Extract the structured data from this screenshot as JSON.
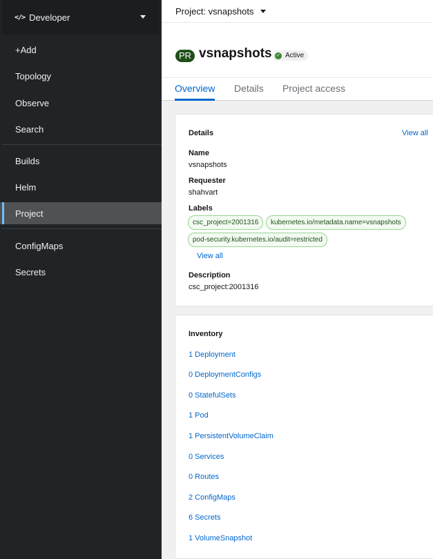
{
  "sidebar": {
    "perspective": "Developer",
    "items": [
      {
        "label": "+Add"
      },
      {
        "label": "Topology"
      },
      {
        "label": "Observe"
      },
      {
        "label": "Search"
      },
      {
        "label": "Builds"
      },
      {
        "label": "Helm"
      },
      {
        "label": "Project"
      },
      {
        "label": "ConfigMaps"
      },
      {
        "label": "Secrets"
      }
    ]
  },
  "topbar": {
    "project_selector": "Project: vsnapshots"
  },
  "header": {
    "badge": "PR",
    "title": "vsnapshots",
    "status": "Active"
  },
  "tabs": [
    "Overview",
    "Details",
    "Project access"
  ],
  "details": {
    "title": "Details",
    "view_all": "View all",
    "name_label": "Name",
    "name_value": "vsnapshots",
    "requester_label": "Requester",
    "requester_value": "shahvart",
    "labels_label": "Labels",
    "labels": [
      "csc_project=2001316",
      "kubernetes.io/metadata.name=vsnapshots",
      "pod-security.kubernetes.io/audit=restricted"
    ],
    "labels_view_all": "View all",
    "description_label": "Description",
    "description_value": "csc_project:2001316"
  },
  "inventory": {
    "title": "Inventory",
    "items": [
      "1 Deployment",
      "0 DeploymentConfigs",
      "0 StatefulSets",
      "1 Pod",
      "1 PersistentVolumeClaim",
      "0 Services",
      "0 Routes",
      "2 ConfigMaps",
      "6 Secrets",
      "1 VolumeSnapshot"
    ]
  },
  "colors": {
    "accent": "#0066cc",
    "sidebar_bg": "#212427",
    "status_ok": "#3e8635",
    "label_border": "#95d58e"
  }
}
